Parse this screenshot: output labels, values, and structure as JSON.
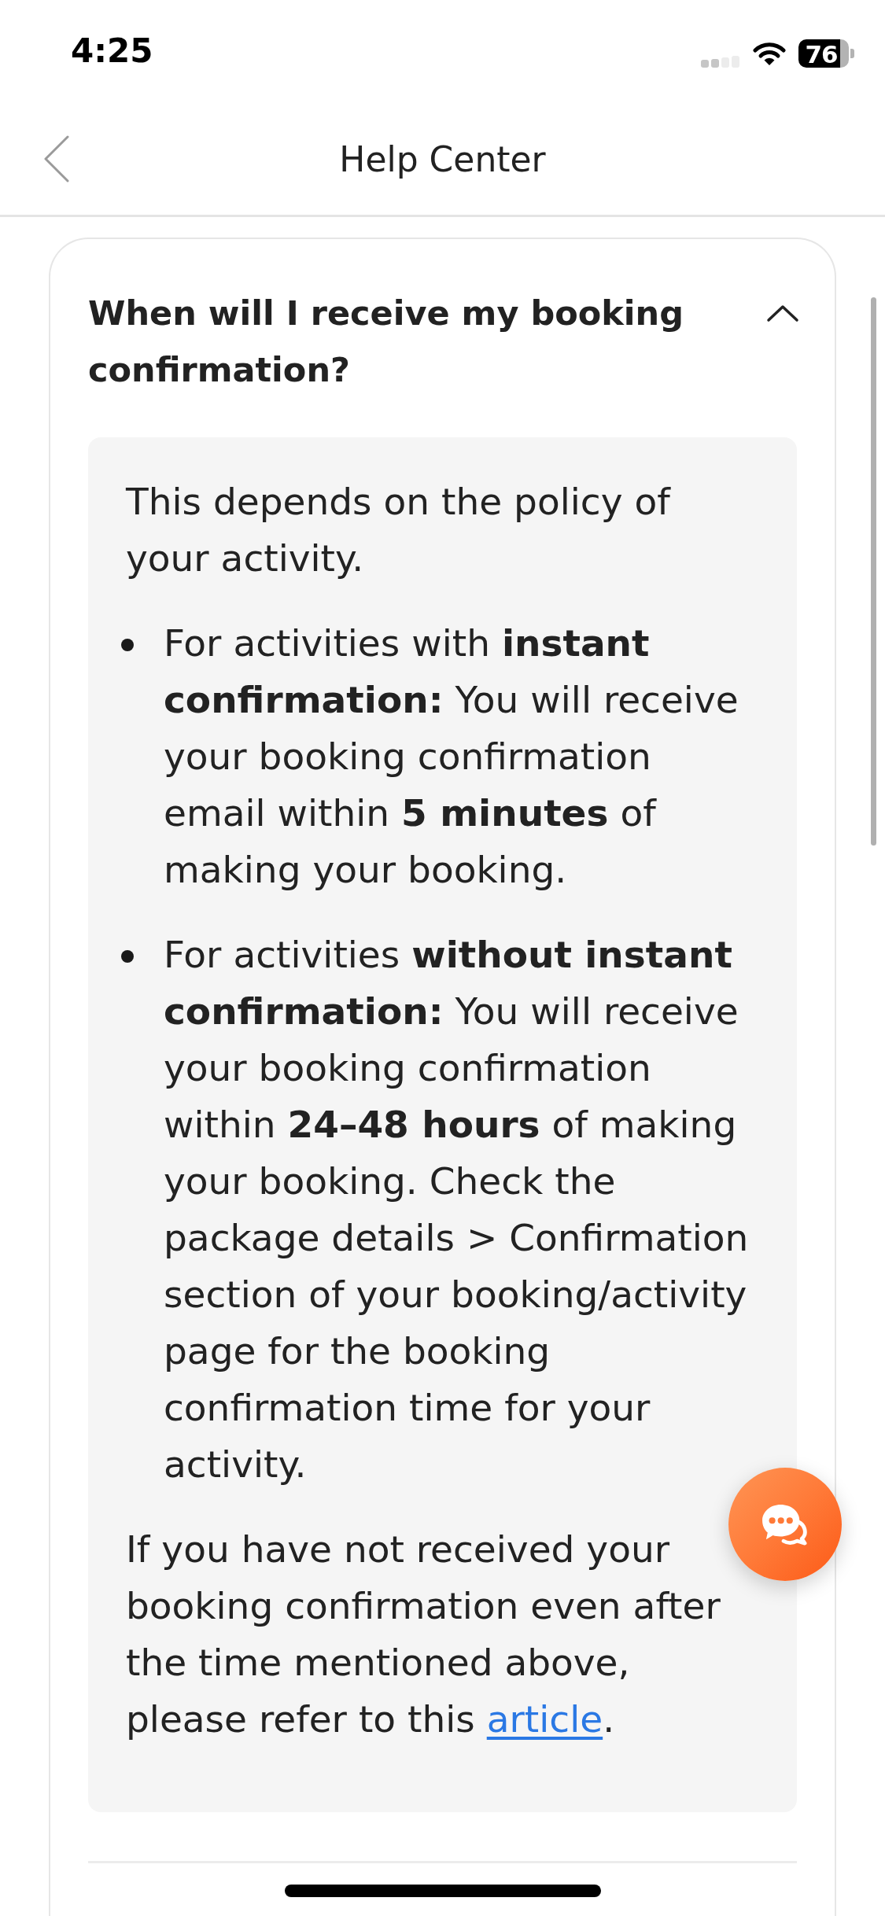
{
  "status_bar": {
    "time": "4:25",
    "battery": "76"
  },
  "header": {
    "title": "Help Center"
  },
  "faq": [
    {
      "question": "When will I receive my booking confirmation?",
      "expanded": true,
      "answer": {
        "intro": "This depends on the policy of your activity.",
        "bullets": [
          "For activities with **instant confirmation:** You will receive your booking confirmation email within **5 minutes** of making your booking.",
          "For activities **without instant confirmation:** You will receive your booking confirmation within **24–48 hours** of making your booking. Check the package details > Confirmation section of your booking/activity page for the booking confirmation time for your activity."
        ],
        "closing": {
          "text": "If you have not received your booking confirmation even after the time mentioned above, please refer to this",
          "link": "article",
          "after": "."
        }
      }
    }
  ]
}
